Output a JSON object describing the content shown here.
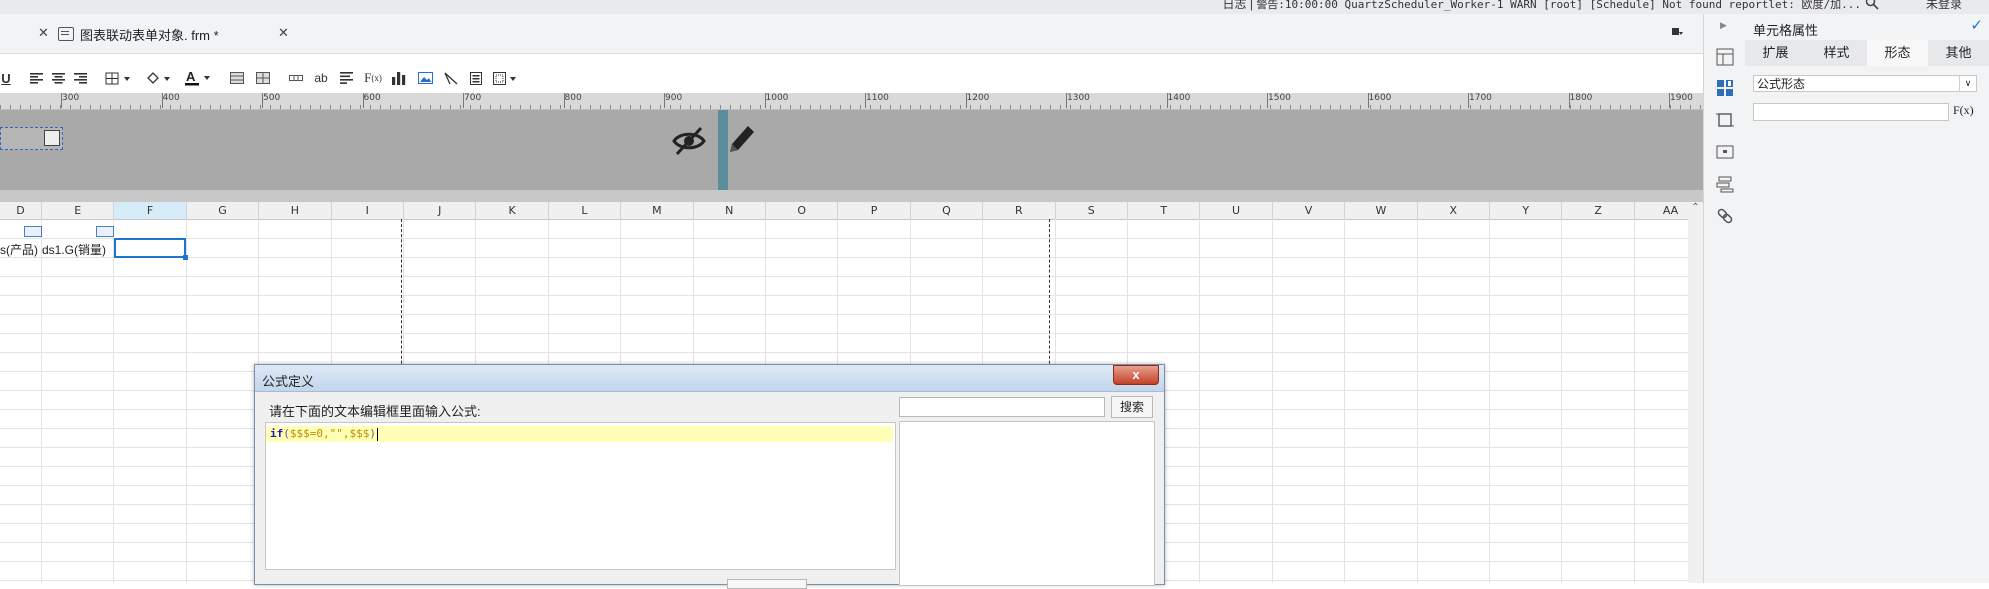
{
  "status_bar": {
    "log_label": "日志",
    "separator": "|",
    "warning_text": "警告:10:00:00 QuartzScheduler_Worker-1 WARN [root] [Schedule] Not found reportlet: 欧度/加...",
    "login_label": "未登录"
  },
  "tabs": {
    "items": [
      {
        "label": "图表联动表单对象. frm *"
      }
    ]
  },
  "toolbar": {
    "underline_label": "U"
  },
  "ruler": {
    "marks": [
      "300",
      "400",
      "500",
      "600",
      "700",
      "800",
      "900",
      "1000",
      "1100",
      "1200",
      "1300",
      "1400",
      "1500",
      "1600",
      "1700",
      "1800",
      "1900"
    ]
  },
  "sheet": {
    "columns": [
      "D",
      "E",
      "F",
      "G",
      "H",
      "I",
      "J",
      "K",
      "L",
      "M",
      "N",
      "O",
      "P",
      "Q",
      "R",
      "S",
      "T",
      "U",
      "V",
      "W",
      "X",
      "Y",
      "Z",
      "AA"
    ],
    "selected_column": "F",
    "cells": {
      "D2": "s(产品)",
      "E2": "ds1.G(销量)"
    }
  },
  "panel": {
    "title": "单元格属性",
    "tabs": [
      "扩展",
      "样式",
      "形态",
      "其他"
    ],
    "active_tab": "形态",
    "form_select": "公式形态",
    "fx_label": "F(x)"
  },
  "dialog": {
    "title": "公式定义",
    "close_label": "x",
    "prompt": "请在下面的文本编辑框里面输入公式:",
    "search_button": "搜索",
    "formula": {
      "keyword": "if",
      "open_paren": "(",
      "arg1": "$$$=0,\"\",$$$",
      "close_paren": ")"
    }
  },
  "colors": {
    "accent": "#1e74d0",
    "gray_section": "#a9a9a9",
    "formula_line": "#ffffb8",
    "close_button": "#c3412a"
  }
}
